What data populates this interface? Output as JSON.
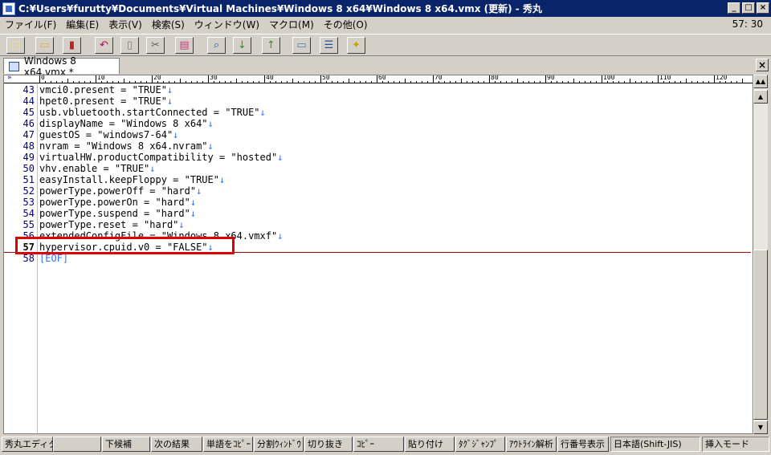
{
  "window": {
    "title": "C:¥Users¥furutty¥Documents¥Virtual Machines¥Windows 8 x64¥Windows 8 x64.vmx (更新) - 秀丸",
    "min_label": "_",
    "max_label": "□",
    "close_label": "×"
  },
  "menu": {
    "items": [
      "ファイル(F)",
      "編集(E)",
      "表示(V)",
      "検索(S)",
      "ウィンドウ(W)",
      "マクロ(M)",
      "その他(O)"
    ],
    "cursor_position": "57: 30"
  },
  "toolbar": {
    "buttons": [
      {
        "name": "new-file-icon",
        "glyph": "▢",
        "color": "#f0e080"
      },
      {
        "name": "open-folder-icon",
        "glyph": "▭",
        "color": "#e0b040"
      },
      {
        "name": "save-icon",
        "glyph": "▮",
        "color": "#c02020"
      },
      {
        "name": "undo-icon",
        "glyph": "↶",
        "color": "#c00060"
      },
      {
        "name": "copy-icon",
        "glyph": "▯",
        "color": "#808080"
      },
      {
        "name": "cut-icon",
        "glyph": "✂",
        "color": "#606060"
      },
      {
        "name": "paste-icon",
        "glyph": "▤",
        "color": "#c04080"
      },
      {
        "name": "find-icon",
        "glyph": "⌕",
        "color": "#2060c0"
      },
      {
        "name": "find-down-icon",
        "glyph": "↓",
        "color": "#20a020"
      },
      {
        "name": "find-up-icon",
        "glyph": "↑",
        "color": "#20a020"
      },
      {
        "name": "window-icon",
        "glyph": "▭",
        "color": "#4080c0"
      },
      {
        "name": "split-window-icon",
        "glyph": "☰",
        "color": "#2050a0"
      },
      {
        "name": "hidemaru-icon",
        "glyph": "✦",
        "color": "#d0a000"
      }
    ]
  },
  "tab": {
    "label": "Windows 8 x64.vmx *",
    "close_label": "×"
  },
  "ruler": {
    "marker": "»",
    "labels": [
      "0",
      "10",
      "20",
      "30",
      "40",
      "50",
      "60",
      "70",
      "80",
      "90",
      "100",
      "110",
      "120"
    ]
  },
  "editor": {
    "eol_mark": "↓",
    "current_line": 57,
    "lines": [
      {
        "num": "43",
        "text": "vmci0.present = \"TRUE\""
      },
      {
        "num": "44",
        "text": "hpet0.present = \"TRUE\""
      },
      {
        "num": "45",
        "text": "usb.vbluetooth.startConnected = \"TRUE\""
      },
      {
        "num": "46",
        "text": "displayName = \"Windows 8 x64\""
      },
      {
        "num": "47",
        "text": "guestOS = \"windows7-64\""
      },
      {
        "num": "48",
        "text": "nvram = \"Windows 8 x64.nvram\""
      },
      {
        "num": "49",
        "text": "virtualHW.productCompatibility = \"hosted\""
      },
      {
        "num": "50",
        "text": "vhv.enable = \"TRUE\""
      },
      {
        "num": "51",
        "text": "easyInstall.keepFloppy = \"TRUE\""
      },
      {
        "num": "52",
        "text": "powerType.powerOff = \"hard\""
      },
      {
        "num": "53",
        "text": "powerType.powerOn = \"hard\""
      },
      {
        "num": "54",
        "text": "powerType.suspend = \"hard\""
      },
      {
        "num": "55",
        "text": "powerType.reset = \"hard\""
      },
      {
        "num": "56",
        "text": "extendedConfigFile = \"Windows 8 x64.vmxf\""
      },
      {
        "num": "57",
        "text": "hypervisor.cpuid.v0 = \"FALSE\""
      }
    ],
    "eof_line_num": "58",
    "eof_text": "[EOF]"
  },
  "scrollbar": {
    "top_label": "▲▲",
    "up_label": "▲",
    "down_label": "▼"
  },
  "fkeys": [
    {
      "label": "秀丸エディタヘ"
    },
    {
      "label": ""
    },
    {
      "label": "下候補"
    },
    {
      "label": "次の結果"
    },
    {
      "label": "単語をｺﾋﾟｰ"
    },
    {
      "label": "分割ｳｨﾝﾄﾞｳ"
    },
    {
      "label": "切り抜き"
    },
    {
      "label": "ｺﾋﾟｰ"
    },
    {
      "label": "貼り付け"
    },
    {
      "label": "ﾀｸﾞｼﾞｬﾝﾌﾟ"
    },
    {
      "label": "ｱｳﾄﾗｲﾝ解析"
    },
    {
      "label": "行番号表示"
    }
  ],
  "status": {
    "encoding": "日本語(Shift-JIS)",
    "mode": "挿入モード"
  }
}
